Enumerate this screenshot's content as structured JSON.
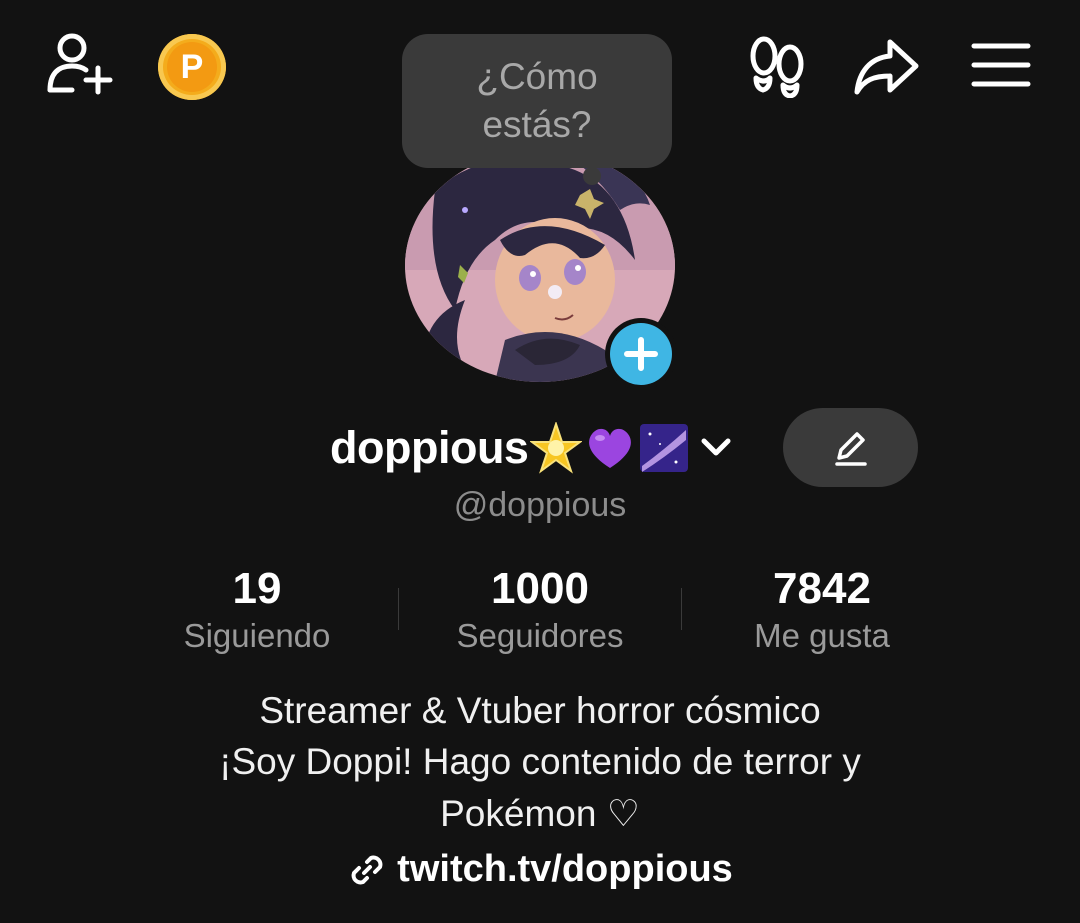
{
  "header": {
    "add_friend_icon": "person-plus-icon",
    "coin_icon": "p-coin-icon",
    "coin_label": "P",
    "footprints_icon": "footprints-icon",
    "share_icon": "share-arrow-icon",
    "menu_icon": "hamburger-menu-icon"
  },
  "status_bubble": {
    "line1": "¿Cómo",
    "line2": "estás?"
  },
  "profile": {
    "display_name": "doppious",
    "name_emojis": [
      "glowing-star",
      "purple-heart",
      "milky-way"
    ],
    "handle": "@doppious",
    "edit_icon": "pencil-icon",
    "add_avatar_icon": "plus-icon"
  },
  "stats": [
    {
      "value": "19",
      "label": "Siguiendo"
    },
    {
      "value": "1000",
      "label": "Seguidores"
    },
    {
      "value": "7842",
      "label": "Me gusta"
    }
  ],
  "bio": {
    "line1": "Streamer & Vtuber horror cósmico",
    "line2": "¡Soy Doppi! Hago contenido de terror y",
    "line3": "Pokémon ♡",
    "link": "twitch.tv/doppious",
    "link_icon": "link-icon"
  },
  "colors": {
    "background": "#121212",
    "accent_blue": "#3fb6e4",
    "coin_orange": "#f4ac1c",
    "bubble_gray": "#3a3a3a"
  }
}
